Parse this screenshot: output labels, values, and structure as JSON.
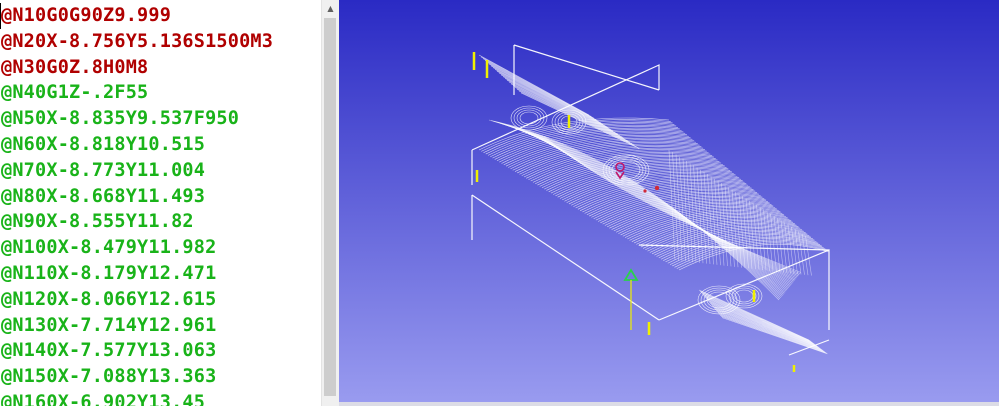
{
  "editor": {
    "lines": [
      {
        "text": "@N10G0G90Z9.999",
        "kind": "modal"
      },
      {
        "text": "@N20X-8.756Y5.136S1500M3",
        "kind": "modal"
      },
      {
        "text": "@N30G0Z.8H0M8",
        "kind": "modal"
      },
      {
        "text": "@N40G1Z-.2F55",
        "kind": "motion"
      },
      {
        "text": "@N50X-8.835Y9.537F950",
        "kind": "motion"
      },
      {
        "text": "@N60X-8.818Y10.515",
        "kind": "motion"
      },
      {
        "text": "@N70X-8.773Y11.004",
        "kind": "motion"
      },
      {
        "text": "@N80X-8.668Y11.493",
        "kind": "motion"
      },
      {
        "text": "@N90X-8.555Y11.82",
        "kind": "motion"
      },
      {
        "text": "@N100X-8.479Y11.982",
        "kind": "motion"
      },
      {
        "text": "@N110X-8.179Y12.471",
        "kind": "motion"
      },
      {
        "text": "@N120X-8.066Y12.615",
        "kind": "motion"
      },
      {
        "text": "@N130X-7.714Y12.961",
        "kind": "motion"
      },
      {
        "text": "@N140X-7.577Y13.063",
        "kind": "motion"
      },
      {
        "text": "@N150X-7.088Y13.363",
        "kind": "motion"
      },
      {
        "text": "@N160X-6.902Y13.45",
        "kind": "motion"
      }
    ],
    "colors": {
      "modal": "#b00000",
      "motion": "#19b319"
    }
  },
  "viewport": {
    "background_top": "#2a2ac4",
    "background_bottom": "#9a9cf0",
    "toolpath_color": "#ffffff",
    "plunge_color": "#f0f000",
    "markers": [
      "start-triangle-icon",
      "tool-position-icon"
    ]
  }
}
